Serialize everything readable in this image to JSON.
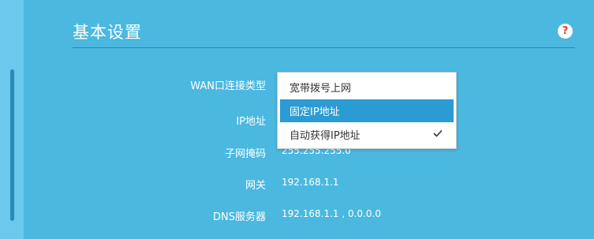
{
  "section": {
    "title": "基本设置",
    "help_icon": "question-icon",
    "help_symbol": "?"
  },
  "fields": {
    "wan_type": {
      "label": "WAN口连接类型"
    },
    "ip": {
      "label": "IP地址"
    },
    "subnet": {
      "label": "子网掩码",
      "value": "255.255.255.0"
    },
    "gateway": {
      "label": "网关",
      "value": "192.168.1.1"
    },
    "dns": {
      "label": "DNS服务器",
      "value": "192.168.1.1 , 0.0.0.0"
    }
  },
  "dropdown": {
    "options": [
      {
        "label": "宽带拨号上网"
      },
      {
        "label": "固定IP地址"
      },
      {
        "label": "自动获得IP地址"
      }
    ],
    "highlighted_option": "固定IP地址",
    "checked_option": "自动获得IP地址",
    "check_icon": "checkmark-icon"
  },
  "colors": {
    "background": "#4bb8e0",
    "highlight": "#2b9bd3",
    "help_icon_glyph": "#e63b2e"
  }
}
